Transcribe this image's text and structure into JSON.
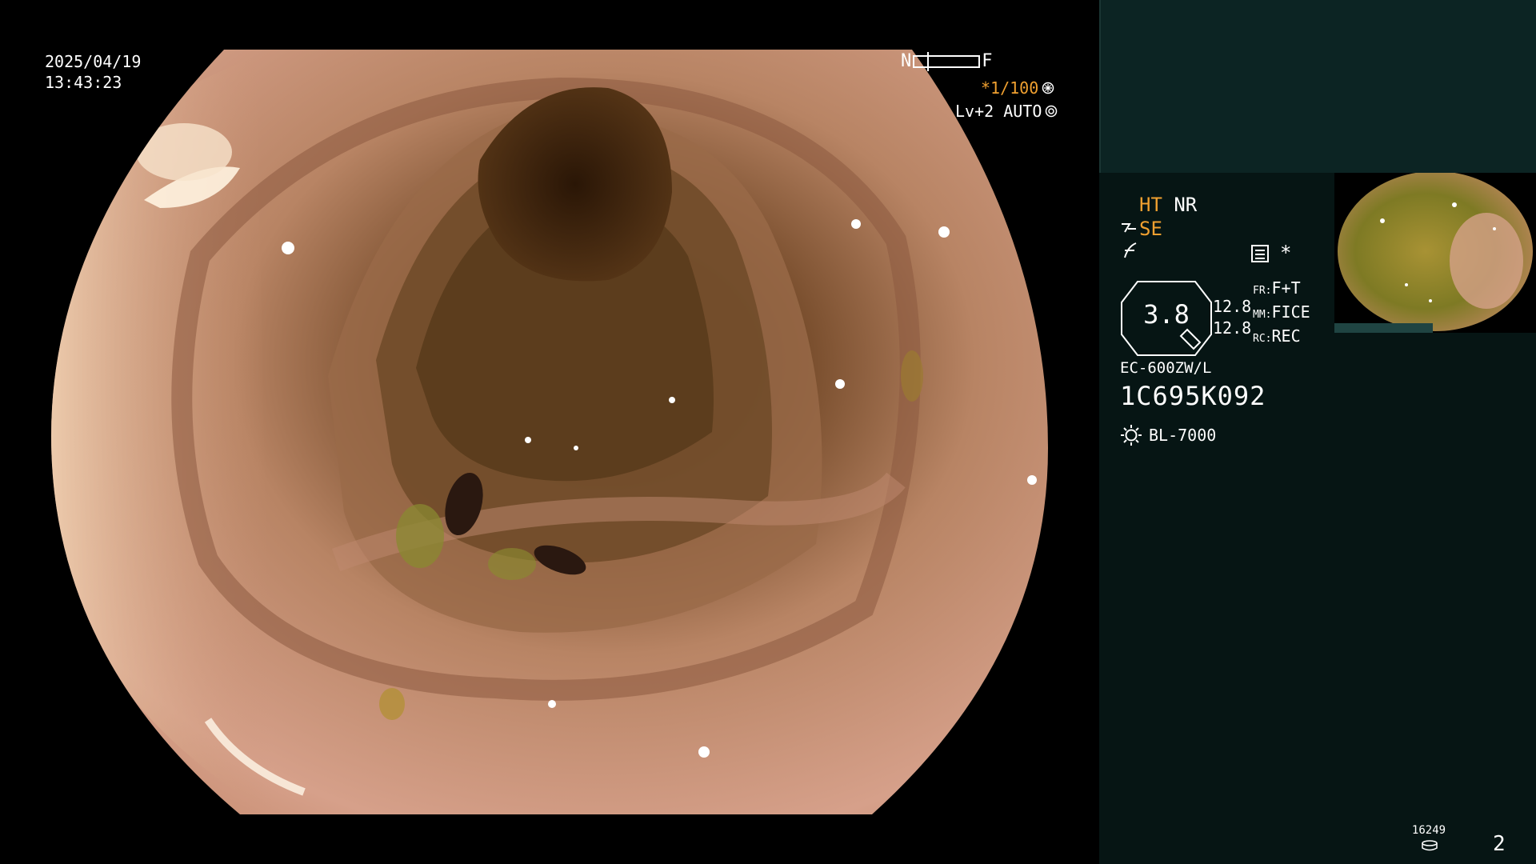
{
  "overlay": {
    "date": "2025/04/19",
    "time": "13:43:23",
    "gauge_near": "N",
    "gauge_far": "F",
    "shutter": "*1/100",
    "iris": "Lv+2 AUTO"
  },
  "panel": {
    "ht": "HT",
    "nr": "NR",
    "se": "SE",
    "star": "*",
    "zoom": "3.8",
    "val1": "12.8",
    "val2": "12.8",
    "mode_rows": [
      {
        "key": "FR:",
        "value": "F+T"
      },
      {
        "key": "MM:",
        "value": "FICE"
      },
      {
        "key": "RC:",
        "value": "REC"
      }
    ],
    "scope_model": "EC-600ZW/L",
    "scope_serial": "1C695K092",
    "light_source": "BL-7000",
    "counter": "16249",
    "page_number": "2"
  },
  "colors": {
    "accent_orange": "#f0a030",
    "panel_bg": "#061514",
    "panel_top": "#0c2423"
  }
}
